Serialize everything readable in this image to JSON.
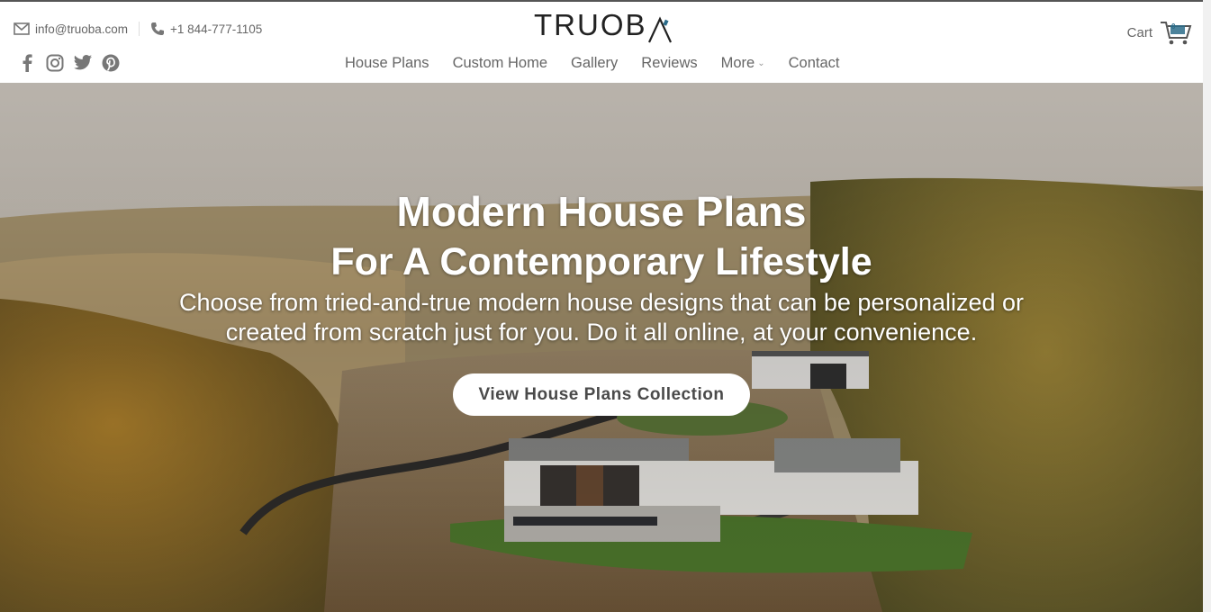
{
  "header": {
    "email": "info@truoba.com",
    "phone": "+1 844-777-1105",
    "logo_text": "TRUOB",
    "cart_label": "Cart",
    "cart_count": "0",
    "social": [
      "facebook-icon",
      "instagram-icon",
      "twitter-icon",
      "pinterest-icon"
    ]
  },
  "nav": {
    "items": [
      "House Plans",
      "Custom Home",
      "Gallery",
      "Reviews",
      "More",
      "Contact"
    ]
  },
  "hero": {
    "title_line1": "Modern House Plans",
    "title_line2": "For A Contemporary Lifestyle",
    "subtitle_line1": "Choose from tried-and-true modern house designs that can be personalized or",
    "subtitle_line2": "created from scratch just for you. Do it all online, at your convenience.",
    "cta_label": "View House Plans Collection"
  },
  "colors": {
    "accent": "#2b6c8a",
    "nav_text": "#666666",
    "cta_text": "#4a4a4a"
  }
}
